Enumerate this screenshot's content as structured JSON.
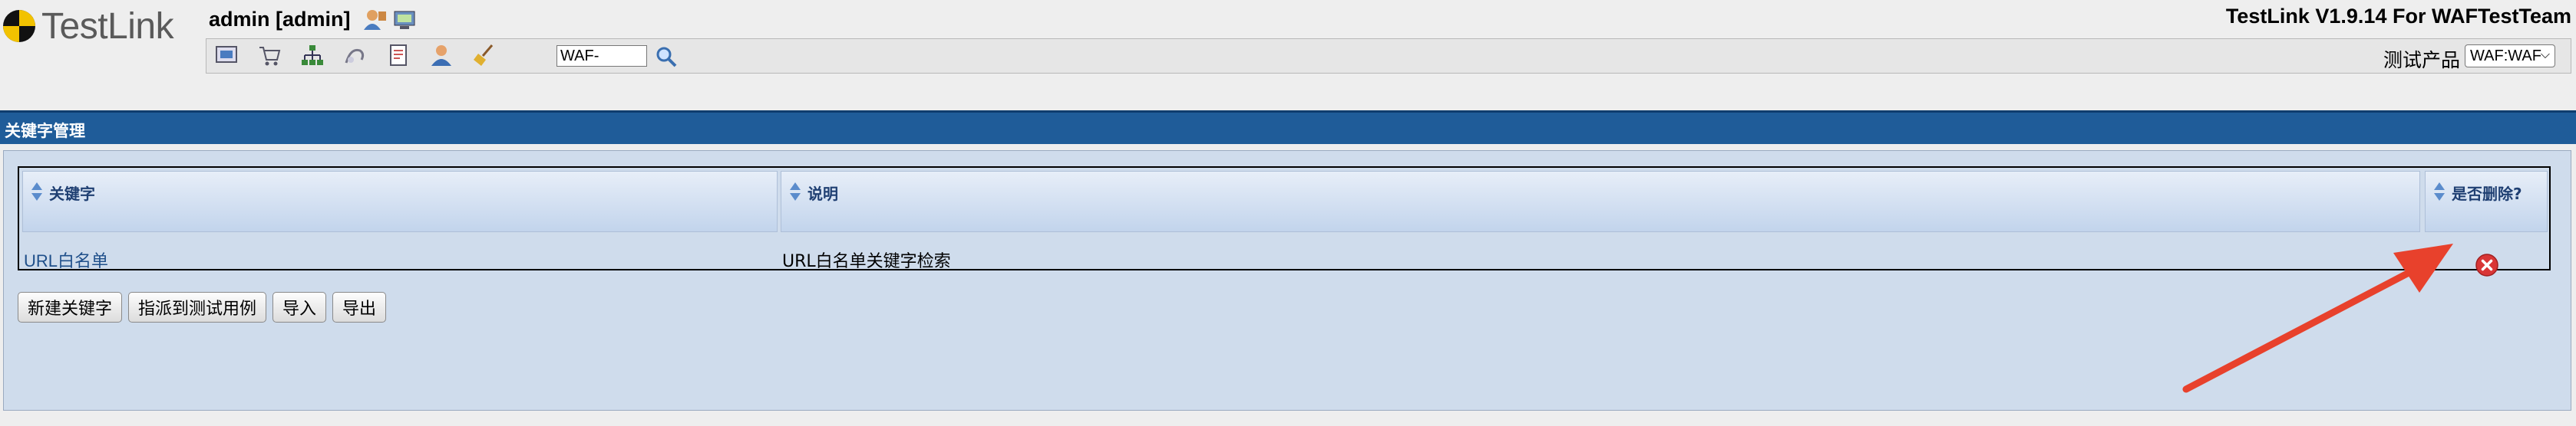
{
  "header": {
    "logo_text": "TestLink",
    "user": "admin [admin]",
    "version": "TestLink V1.9.14 For WAFTestTeam",
    "search_value": "WAF-",
    "product_label": "测试产品",
    "product_selected": "WAF:WAF"
  },
  "page": {
    "title": "关键字管理"
  },
  "table": {
    "columns": [
      "关键字",
      "说明",
      "是否删除?"
    ],
    "rows": [
      {
        "keyword": "URL白名单",
        "notes": "URL白名单关键字检索"
      }
    ]
  },
  "buttons": {
    "create": "新建关键字",
    "assign": "指派到测试用例",
    "import": "导入",
    "export": "导出"
  },
  "colors": {
    "title_bar": "#1f5c99",
    "workframe": "#cfdcec",
    "annotation_arrow": "#e8412c",
    "delete_icon": "#d93636"
  }
}
